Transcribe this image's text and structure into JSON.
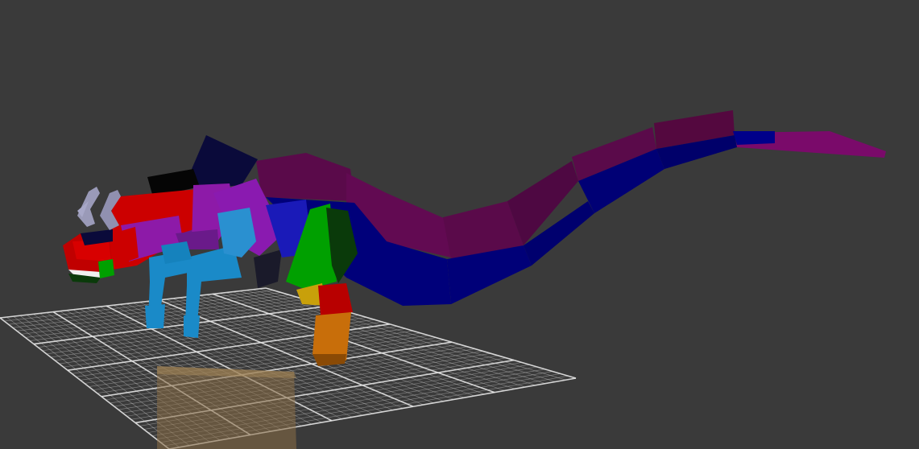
{
  "viewport": {
    "background": "#3a3a3a",
    "grid_color": "#c8c8c8",
    "grid_major_color": "#e6e6e6",
    "ground_block_color": "#8a6e45"
  },
  "model": {
    "description_color_palette": {
      "red": "#cc0000",
      "purple": "#8d1aa8",
      "dark_purple": "#5a0a4a",
      "magenta": "#7a0a6a",
      "blue": "#00007a",
      "navy": "#0a0a3a",
      "cyan": "#1a8ac8",
      "green": "#00a000",
      "dark_green": "#0a3a0a",
      "orange": "#c86e0a",
      "black": "#050505",
      "antler": "#9a9ab8",
      "white": "#f0f0f0"
    }
  }
}
